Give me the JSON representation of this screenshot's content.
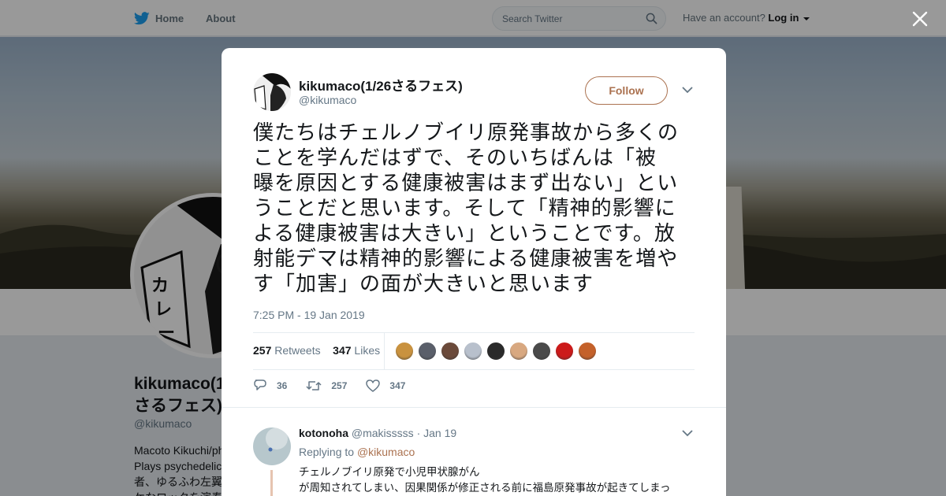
{
  "nav": {
    "home_label": "Home",
    "about_label": "About"
  },
  "search": {
    "placeholder": "Search Twitter"
  },
  "account": {
    "prompt": "Have an account?",
    "login_label": "Log in"
  },
  "profile": {
    "name": "kikumaco(1/26さるフェス)",
    "handle": "@kikumaco",
    "bio": "Macoto Kikuchi/ph\nPlays psychedelic\n者、ゆるふわ左翼\nケなロックを演奏"
  },
  "tweet": {
    "author_name": "kikumaco(1/26さるフェス)",
    "author_handle": "@kikumaco",
    "follow_label": "Follow",
    "text": "僕たちはチェルノブイリ原発事故から多くの\nことを学んだはずで、そのいちばんは「被\n曝を原因とする健康被害はまず出ない」とい\nうことだと思います。そして「精神的影響に\nよる健康被害は大きい」ということです。放\n射能デマは精神的影響による健康被害を増や\nす「加害」の面が大きいと思います",
    "timestamp": "7:25 PM - 19 Jan 2019",
    "retweets": {
      "count": "257",
      "label": "Retweets"
    },
    "likes": {
      "count": "347",
      "label": "Likes"
    },
    "liker_colors": [
      "#c9923f",
      "#5a5f6a",
      "#6b4a3a",
      "#b8c0cc",
      "#2a2a2a",
      "#d8a880",
      "#4a4a4a",
      "#cc1a1a",
      "#c4612a"
    ],
    "actions": {
      "replies": "36",
      "retweets": "257",
      "likes": "347"
    }
  },
  "reply": {
    "name": "kotonoha",
    "handle": "@makisssss",
    "separator": "·",
    "date": "Jan 19",
    "replying_prefix": "Replying to",
    "replying_to": "@kikumaco",
    "text": "チェルノブイリ原発で小児甲状腺がん\nが周知されてしまい、因果関係が修正される前に福島原発事故が起きてしまっ"
  },
  "colors": {
    "accent": "#ab7250",
    "twitter_blue": "#1da1f2",
    "muted": "#657786"
  }
}
